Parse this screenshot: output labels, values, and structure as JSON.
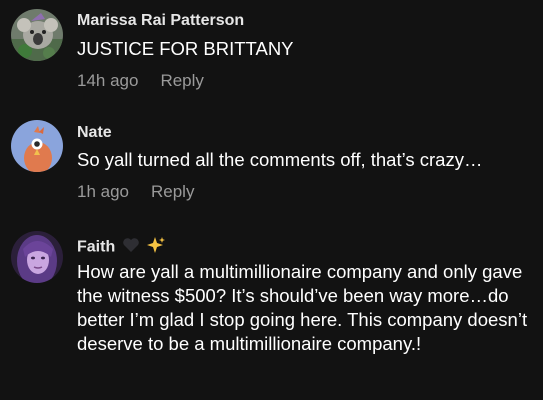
{
  "comments": [
    {
      "author": "Marissa Rai Patterson",
      "text": "JUSTICE FOR BRITTANY",
      "time": "14h ago",
      "reply": "Reply",
      "avatar_icon": "koala-photo-avatar"
    },
    {
      "author": "Nate",
      "text": "So yall turned all the comments off, that’s crazy…",
      "time": "1h ago",
      "reply": "Reply",
      "avatar_icon": "orange-bird-avatar"
    },
    {
      "author": "Faith",
      "author_emojis": [
        "black-heart-icon",
        "sparkles-icon"
      ],
      "text": "How are yall a multimillionaire company and only gave the witness $500? It’s should’ve been way more…do better I’m glad I stop going here. This company doesn’t deserve to be a multimillionaire company.!",
      "avatar_icon": "person-photo-avatar"
    }
  ],
  "colors": {
    "background": "#121212",
    "author": "#e6e6e6",
    "text": "#ffffff",
    "meta": "#9a9a9a"
  }
}
